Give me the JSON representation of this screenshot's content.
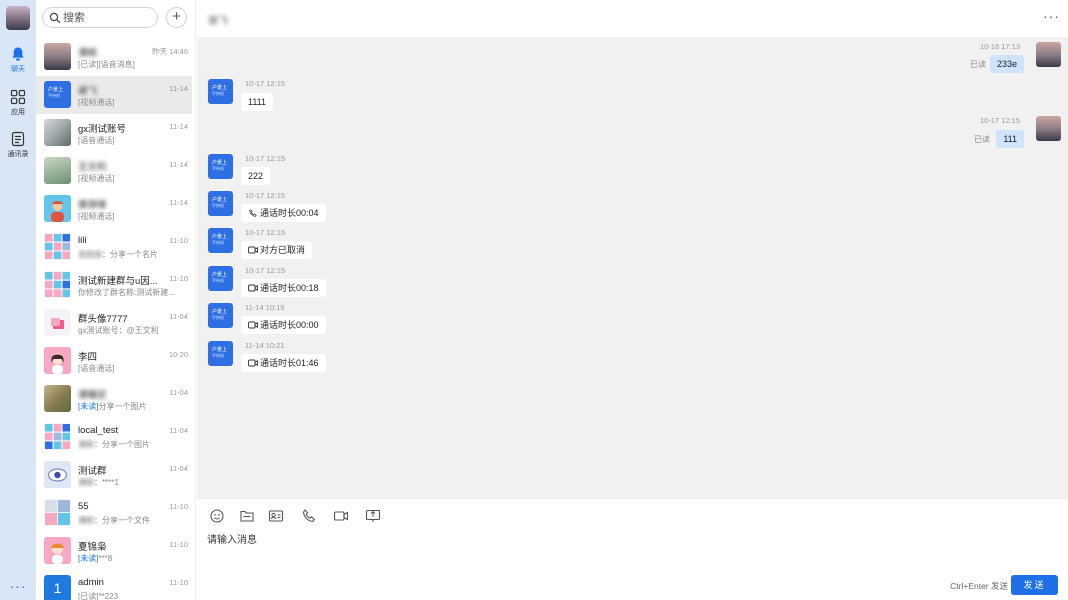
{
  "nav": {
    "items": [
      {
        "label": "聊天",
        "icon": "bell-icon",
        "active": true
      },
      {
        "label": "应用",
        "icon": "apps-grid-icon",
        "active": false
      },
      {
        "label": "通讯录",
        "icon": "contacts-book-icon",
        "active": false
      }
    ],
    "more": "···"
  },
  "search": {
    "placeholder": "搜索",
    "add": "+"
  },
  "conversations": [
    {
      "name": "满桃",
      "time": "昨天 14:46",
      "preview": "[已读][语音消息]",
      "avatar": "landscape",
      "blurred_name": true
    },
    {
      "name": "谢飞",
      "time": "11-14",
      "preview": "[视频通话]",
      "avatar": "blue",
      "blurred_name": true,
      "selected": true
    },
    {
      "name": "gx测试账号",
      "time": "11-14",
      "preview": "[语音通话]",
      "avatar": "gray"
    },
    {
      "name": "王文利",
      "time": "11-14",
      "preview": "[视频通话]",
      "avatar": "green",
      "blurred_name": true
    },
    {
      "name": "黄铮锋",
      "time": "11-14",
      "preview": "[视频通话]",
      "avatar": "teal",
      "blurred_name": true
    },
    {
      "name": "lili",
      "time": "11-10",
      "preview_sender": "张张张",
      "preview": "分享一个名片",
      "avatar": "grid"
    },
    {
      "name": "测试新建群与u因...",
      "time": "11-10",
      "preview": "你修改了群名称:测试新建...",
      "avatar": "grid"
    },
    {
      "name": "群头像7777",
      "time": "11-04",
      "preview": "gx测试账号：@王文利",
      "avatar": "light"
    },
    {
      "name": "李四",
      "time": "10-20",
      "preview": "[语音通话]",
      "avatar": "pink"
    },
    {
      "name": "谭耀武",
      "time": "11-04",
      "preview_unread": "[未读]",
      "preview": "分享一个图片",
      "avatar": "food",
      "blurred_name": true
    },
    {
      "name": "local_test",
      "time": "11-04",
      "preview_sender": "满桃",
      "preview": "分享一个图片",
      "avatar": "grid"
    },
    {
      "name": "测试群",
      "time": "11-04",
      "preview_sender": "满桃",
      "preview": "****1",
      "avatar": "eye"
    },
    {
      "name": "55",
      "time": "11-10",
      "preview_sender": "满桃",
      "preview": "分享一个文件",
      "avatar": "grid"
    },
    {
      "name": "夏锦枭",
      "time": "11-10",
      "preview_unread": "[未读]",
      "preview": "***8",
      "avatar": "pink"
    },
    {
      "name": "admin",
      "time": "11-10",
      "preview": "[已读]**223",
      "avatar": "num",
      "avatar_text": "1"
    }
  ],
  "chat": {
    "title": "谢飞",
    "menu": "···",
    "messages": [
      {
        "side": "right",
        "stamp": "10-16 17:13",
        "text": "233e",
        "read": "已读"
      },
      {
        "side": "left",
        "stamp": "10-17 12:15",
        "text": "1111"
      },
      {
        "side": "right",
        "stamp": "10-17 12:15",
        "text": "111",
        "read": "已读"
      },
      {
        "side": "left",
        "stamp": "10-17 12:15",
        "text": "222"
      },
      {
        "side": "left",
        "stamp": "10-17 12:15",
        "text": "通话时长00:04",
        "call": "phone"
      },
      {
        "side": "left",
        "stamp": "10-17 12:15",
        "text": "对方已取消",
        "call": "video"
      },
      {
        "side": "left",
        "stamp": "10-17 12:15",
        "text": "通话时长00:18",
        "call": "video"
      },
      {
        "side": "left",
        "stamp": "11-14 10:19",
        "text": "通话时长00:00",
        "call": "video"
      },
      {
        "side": "left",
        "stamp": "11-14 10:21",
        "text": "通话时长01:46",
        "call": "video"
      }
    ],
    "peer_avatar": {
      "line1": "户景上",
      "line2": "手持机"
    }
  },
  "composer": {
    "tools": [
      "emoji-icon",
      "folder-icon",
      "contact-card-icon",
      "phone-call-icon",
      "video-call-icon",
      "screen-share-icon"
    ],
    "placeholder": "请输入消息",
    "hint": "Ctrl+Enter 发送",
    "send": "发送"
  },
  "colors": {
    "accent": "#1e6fe8",
    "rail": "#d9e6f7",
    "chat_bg": "#f1f1f1",
    "own_bubble": "#cfe3fb"
  }
}
